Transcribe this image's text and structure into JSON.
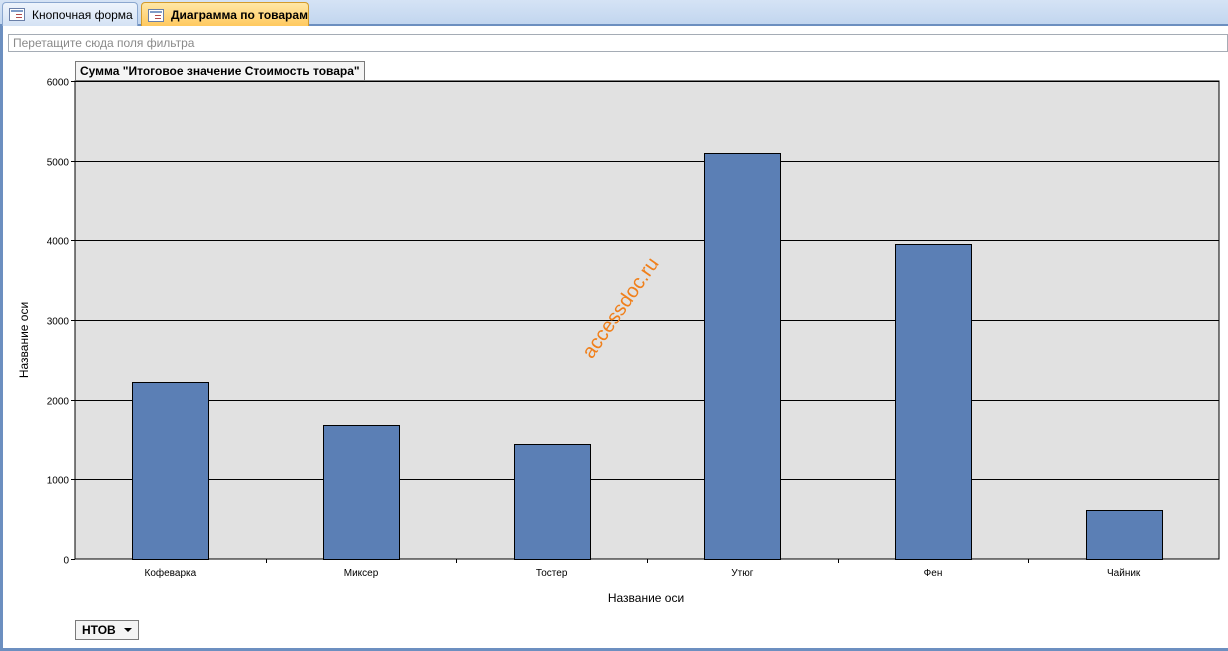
{
  "tabs": [
    {
      "label": "Кнопочная форма",
      "icon": "form-icon",
      "active": false
    },
    {
      "label": "Диаграмма по товарам",
      "icon": "form-icon",
      "active": true
    }
  ],
  "filter_zone": {
    "placeholder": "Перетащите сюда поля фильтра"
  },
  "series_field": {
    "label": "НТОВ"
  },
  "watermark": "accessdoc.ru",
  "colors": {
    "bar": "#5b7fb5",
    "plot_bg": "#e1e1e1",
    "watermark": "#f07f1a"
  },
  "chart_data": {
    "type": "bar",
    "title": "Сумма \"Итоговое значение Стоимость товара\"",
    "xlabel": "Название оси",
    "ylabel": "Название оси",
    "categories": [
      "Кофеварка",
      "Миксер",
      "Тостер",
      "Утюг",
      "Фен",
      "Чайник"
    ],
    "values": [
      2220,
      1680,
      1440,
      5100,
      3950,
      610
    ],
    "ylim": [
      0,
      6000
    ],
    "yticks": [
      0,
      1000,
      2000,
      3000,
      4000,
      5000,
      6000
    ],
    "grid": true,
    "legend": "none"
  }
}
